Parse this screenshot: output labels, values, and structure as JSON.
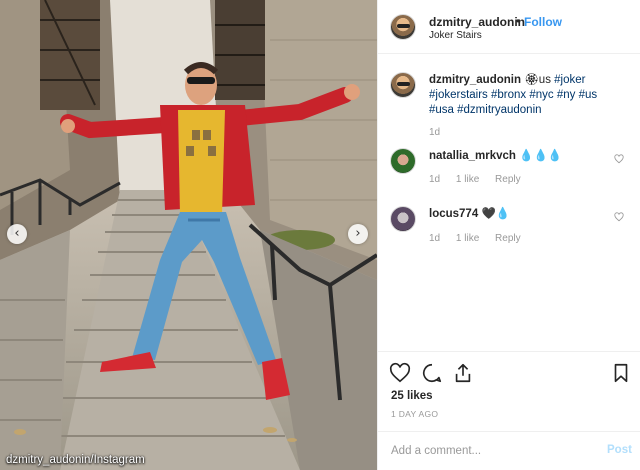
{
  "photo": {
    "credit": "dzmitry_audonin/Instagram",
    "nav_prev_icon": "chevron-left-icon",
    "nav_next_icon": "chevron-right-icon",
    "nav_prev_glyph": "‹",
    "nav_next_glyph": "›"
  },
  "header": {
    "username": "dzmitry_audonin",
    "dot": "•",
    "follow_label": "Follow",
    "location": "Joker Stairs"
  },
  "caption": {
    "username": "dzmitry_audonin",
    "text_prefix": " 🏵us ",
    "hashtags": [
      "#joker",
      "#jokerstairs",
      "#bronx",
      "#nyc",
      "#ny",
      "#us",
      "#usa",
      "#dzmitryaudonin"
    ],
    "age": "1d"
  },
  "comments": [
    {
      "username": "natallia_mrkvch",
      "text": "💧💧💧",
      "age": "1d",
      "likes": "1 like",
      "reply": "Reply"
    },
    {
      "username": "locus774",
      "text": "🖤💧",
      "age": "1d",
      "likes": "1 like",
      "reply": "Reply"
    }
  ],
  "actions": {
    "likes": "25 likes",
    "time": "1 DAY AGO"
  },
  "add_comment": {
    "placeholder": "Add a comment...",
    "post_label": "Post"
  },
  "colors": {
    "link_blue": "#3897f0",
    "hashtag": "#003569",
    "muted": "#999999",
    "post_disabled": "#b2dffc"
  }
}
